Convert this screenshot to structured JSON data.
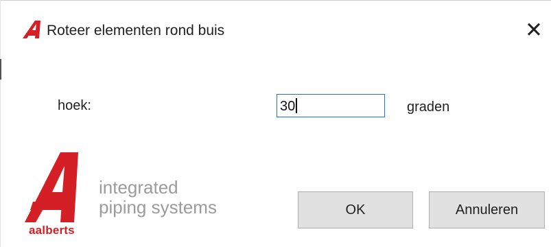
{
  "dialog": {
    "title": "Roteer elementen rond buis",
    "close_glyph": "✕",
    "title_icon": "aalberts-a-logo-icon"
  },
  "form": {
    "angle_label": "hoek:",
    "angle_value": "30",
    "angle_unit": "graden"
  },
  "branding": {
    "logo_icon": "aalberts-logo",
    "logo_word": "aalberts",
    "tagline_line1": "integrated",
    "tagline_line2": "piping systems",
    "brand_color": "#d41f27",
    "tagline_color": "#9b9b9b"
  },
  "buttons": {
    "ok_label": "OK",
    "cancel_label": "Annuleren"
  },
  "colors": {
    "input_focus_border": "#1e74d6",
    "button_background": "#e1e1e1",
    "button_border": "#adadad"
  }
}
